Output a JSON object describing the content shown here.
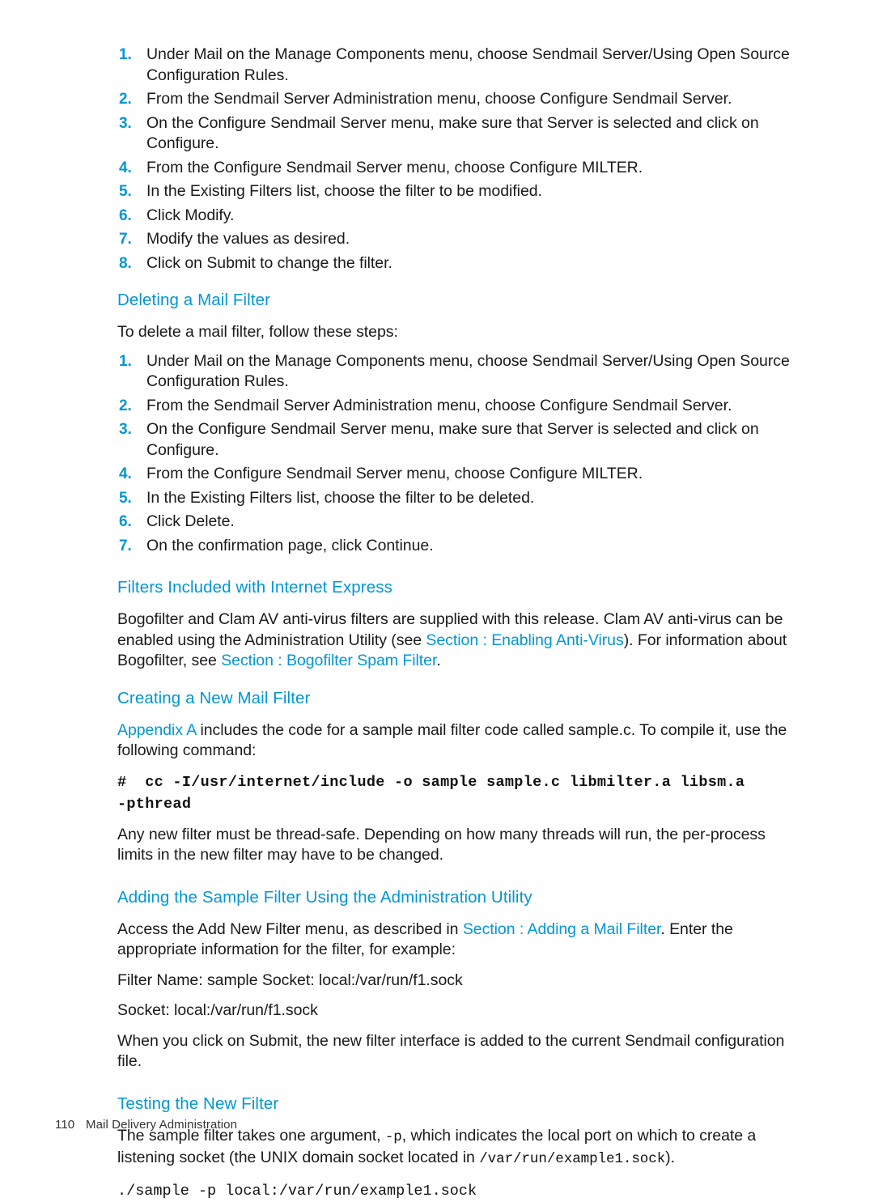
{
  "theme": {
    "accent_blue": "#0096D6",
    "body_text": "#1a1a1a",
    "background": "#ffffff"
  },
  "page": {
    "footer_page_number": "110",
    "footer_title": "Mail Delivery Administration"
  },
  "modify_steps": [
    "Under Mail on the Manage Components menu, choose Sendmail Server/Using Open Source Configuration Rules.",
    "From the Sendmail Server Administration menu, choose Configure Sendmail Server.",
    "On the Configure Sendmail Server menu, make sure that Server is selected and click on Configure.",
    "From the Configure Sendmail Server menu, choose Configure MILTER.",
    "In the Existing Filters list, choose the filter to be modified.",
    "Click Modify.",
    "Modify the values as desired.",
    "Click on Submit to change the filter."
  ],
  "modify_markers": [
    "1.",
    "2.",
    "3.",
    "4.",
    "5.",
    "6.",
    "7.",
    "8."
  ],
  "deleting": {
    "heading": "Deleting a Mail Filter",
    "intro": "To delete a mail filter, follow these steps:",
    "markers": [
      "1.",
      "2.",
      "3.",
      "4.",
      "5.",
      "6.",
      "7."
    ],
    "steps": [
      "Under Mail on the Manage Components menu, choose Sendmail Server/Using Open Source Configuration Rules.",
      "From the Sendmail Server Administration menu, choose Configure Sendmail Server.",
      "On the Configure Sendmail Server menu, make sure that Server is selected and click on Configure.",
      "From the Configure Sendmail Server menu, choose Configure MILTER.",
      "In the Existing Filters list, choose the filter to be deleted.",
      "Click Delete.",
      "On the confirmation page, click Continue."
    ]
  },
  "filters_included": {
    "heading": "Filters Included with Internet Express",
    "para_part1": "Bogofilter and Clam AV anti-virus filters are supplied with this release. Clam AV anti-virus can be enabled using the Administration Utility (see ",
    "link1": "Section : Enabling Anti-Virus",
    "para_part2": "). For information about Bogofilter, see ",
    "link2": "Section : Bogofilter Spam Filter",
    "para_part3": "."
  },
  "creating": {
    "heading": "Creating a New Mail Filter",
    "link_appendix": "Appendix A",
    "para_after_link": " includes the code for a sample mail filter code called sample.c. To compile it, use the following command:",
    "code_line": "#  cc -I/usr/internet/include -o sample sample.c libmilter.a libsm.a\n-pthread",
    "para_thread_safe": "Any new filter must be thread-safe. Depending on how many threads will run, the per-process limits in the new filter may have to be changed."
  },
  "adding_sample": {
    "heading": "Adding the Sample Filter Using the Administration Utility",
    "para_part1": "Access the Add New Filter menu, as described in ",
    "link1": "Section : Adding a Mail Filter",
    "para_part2": ". Enter the appropriate information for the filter, for example:",
    "example_line1": "Filter Name: sample Socket: local:/var/run/f1.sock",
    "example_line2": "Socket: local:/var/run/f1.sock",
    "para_submit": "When you click on Submit, the new filter interface is added to the current Sendmail configuration file."
  },
  "testing": {
    "heading": "Testing the New Filter",
    "para_part1": "The sample filter takes one argument, ",
    "code_arg": "-p",
    "para_part2": ", which indicates the local port on which to create a listening socket (the UNIX domain socket located in ",
    "code_path": "/var/run/example1.sock",
    "para_part3": ").",
    "command": "./sample -p local:/var/run/example1.sock"
  }
}
